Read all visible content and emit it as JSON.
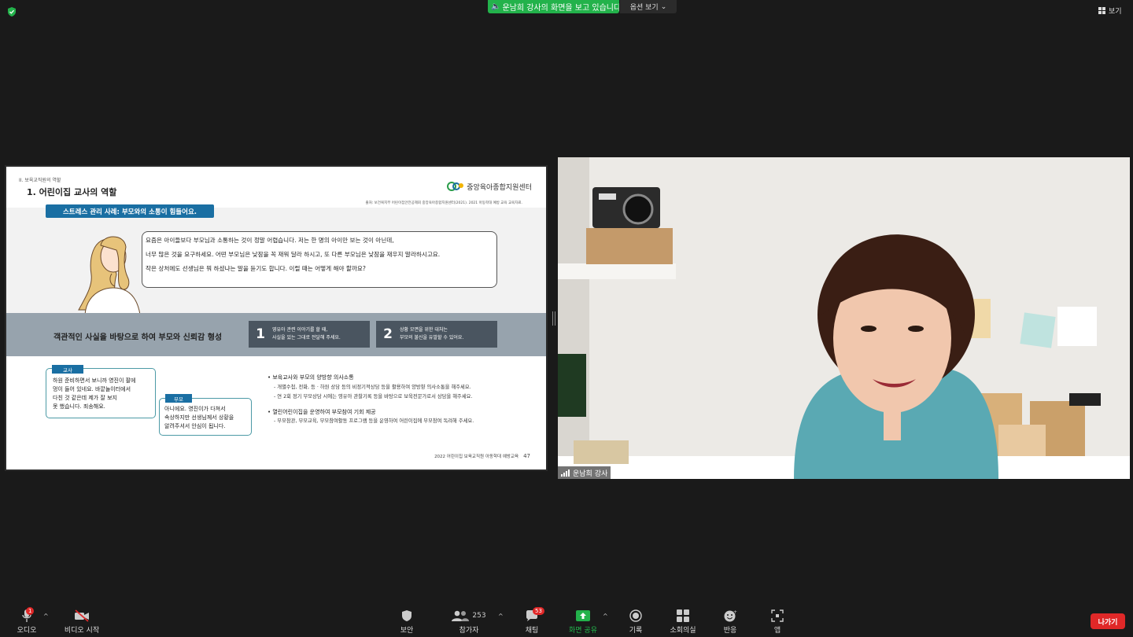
{
  "top_bar": {
    "share_banner": "운남희 강사의 화면을 보고 있습니다",
    "view_options": "옵션 보기",
    "view": "보기"
  },
  "slide": {
    "section": "II. 보육교직원의 역할",
    "title": "1. 어린이집 교사의 역할",
    "logo": "중앙육아종합지원센터",
    "source": "출처: 보건복지부 어린이집안전공제회 중앙육아종합지원센터(2021). 2021 아동학대 예방 교육 교육자료.",
    "case_pill": "스트레스 관리 사례: 부모와의 소통이 힘들어요.",
    "speech_lines": [
      "요즘은 아이들보다 부모님과 소통하는 것이 정말 어렵습니다. 저는 한 명의 아이만 보는 것이 아닌데,",
      "너무 많은 것을 요구하세요. 어떤 부모님은 낮잠을 꼭 재워 달라 하시고, 또 다른 부모님은 낮잠을 재우지 말라하시고요.",
      "작은 상처에도 선생님은 뭐 하셨냐는 말을 듣기도 합니다. 이럴 때는 어떻게 해야 할까요?"
    ],
    "objective": "객관적인 사실을 바탕으로 하여 부모와 신뢰감 형성",
    "tips": [
      {
        "num": "1",
        "line1": "영유아 관련 이야기를 할 때,",
        "line2": "사실을 있는 그대로 전달해 주세요."
      },
      {
        "num": "2",
        "line1": "상황 모면을 위한 대처는",
        "line2": "부모의 불신을 유발할 수 있어요."
      }
    ],
    "teacher_tag": "교사",
    "teacher_lines": [
      "하원 준비하면서 보니까 영진이 팔에",
      "멍이 들어 있네요. 바깥놀이터에서",
      "다친 것 같은데 제가 잘 보지",
      "못 했습니다. 죄송해요."
    ],
    "parent_tag": "부모",
    "parent_lines": [
      "아니에요. 영진이가 다쳐서",
      "속상하지만 선생님께서 상황을",
      "알려주셔서 안심이 됩니다."
    ],
    "bullets": [
      {
        "title": "보육교사와 부모의 양방향 의사소통",
        "subs": [
          "- 개별수첩, 전화, 등 · 하원 상담 등의 비정기적상담 등을 활용하여 양방향 의사소통을 해주세요.",
          "- 연 2회 정기 부모상담 시에는 영유아 관찰기록 등을 바탕으로 보육전문가로서 상담을 해주세요."
        ]
      },
      {
        "title": "열린어린이집을 운영하여 부모참여 기회 제공",
        "subs": [
          "- 부모참관, 부모교육, 부모참여활동 프로그램 등을 운영하여 어린이집에 부모참여 독려해 주세요."
        ]
      }
    ],
    "footer": "2022 어린이집 보육교직원 아동학대 예방교육",
    "page": "47"
  },
  "video": {
    "participant_name": "운남희 강사"
  },
  "toolbar": {
    "audio": "오디오",
    "audio_badge": "1",
    "video": "비디오 시작",
    "security": "보안",
    "participants": "참가자",
    "participants_count": "253",
    "chat": "채팅",
    "chat_badge": "53",
    "share_screen": "화면 공유",
    "record": "기록",
    "breakout": "소회의실",
    "reactions": "반응",
    "apps": "앱",
    "leave": "나가기"
  },
  "colors": {
    "share_green": "#23b24b",
    "leave_red": "#e02828",
    "slide_blue": "#1a6fa3"
  }
}
